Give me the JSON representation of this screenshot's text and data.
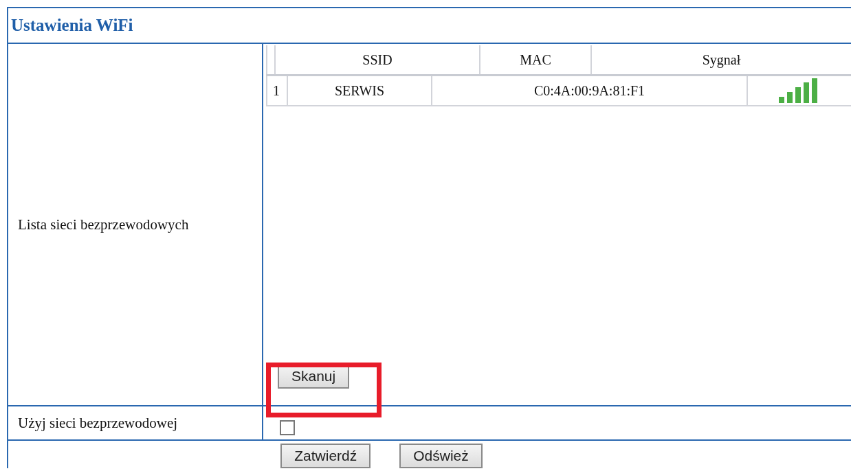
{
  "panel": {
    "title": "Ustawienia WiFi"
  },
  "network_list": {
    "label": "Lista sieci bezprzewodowych",
    "columns": [
      "SSID",
      "MAC",
      "Sygnał"
    ],
    "rows": [
      {
        "index": "1",
        "ssid": "SERWIS",
        "mac": "C0:4A:00:9A:81:F1"
      }
    ],
    "scan_button": "Skanuj",
    "highlighted": true
  },
  "use_wireless": {
    "label": "Użyj sieci bezprzewodowej",
    "checked": false
  },
  "buttons": [
    "Zatwierdź",
    "Odśwież"
  ]
}
